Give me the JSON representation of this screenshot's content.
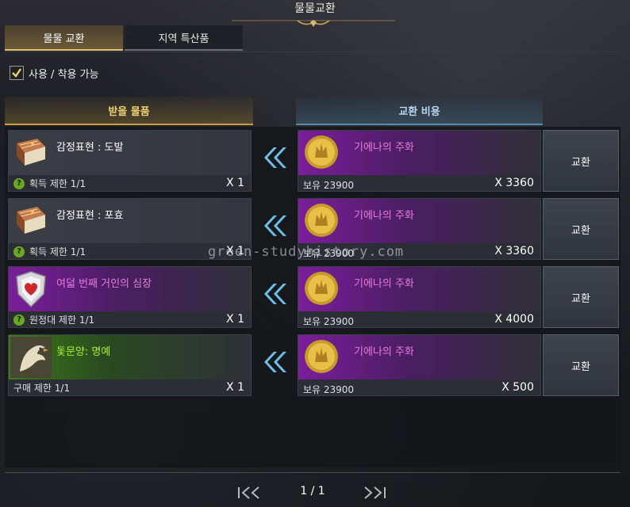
{
  "window": {
    "title": "물물교환"
  },
  "tabs": [
    {
      "label": "물물 교환",
      "active": true
    },
    {
      "label": "지역 특산품",
      "active": false
    }
  ],
  "filter": {
    "label": "사용 / 착용 가능",
    "checked": true
  },
  "columns": {
    "receive": "받을 물품",
    "cost": "교환 비용"
  },
  "rows": [
    {
      "reward": {
        "name": "감정표현 : 도발",
        "limit": "획득 제한 1/1",
        "qty": "X 1",
        "icon": "book-icon"
      },
      "cost": {
        "name": "기에나의 주화",
        "owned": "보유 23900",
        "qty": "X 3360",
        "icon": "gold-coin-icon"
      },
      "button": "교환"
    },
    {
      "reward": {
        "name": "감정표현 : 포효",
        "limit": "획득 제한 1/1",
        "qty": "X 1",
        "icon": "book-icon"
      },
      "cost": {
        "name": "기에나의 주화",
        "owned": "보유 23900",
        "qty": "X 3360",
        "icon": "gold-coin-icon"
      },
      "button": "교환"
    },
    {
      "reward": {
        "name": "여덟 번째 거인의 심장",
        "limit": "원정대 제한 1/1",
        "qty": "X 1",
        "icon": "giant-heart-shield-icon"
      },
      "cost": {
        "name": "기에나의 주화",
        "owned": "보유 23900",
        "qty": "X 4000",
        "icon": "gold-coin-icon"
      },
      "button": "교환"
    },
    {
      "reward": {
        "name": "돛문양: 명예",
        "limit": "구매 제한 1/1",
        "qty": "X 1",
        "icon": "eagle-sail-icon"
      },
      "cost": {
        "name": "기에나의 주화",
        "owned": "보유 23900",
        "qty": "X 500",
        "icon": "gold-coin-icon"
      },
      "button": "교환"
    }
  ],
  "pagination": {
    "current": "1 / 1"
  },
  "watermark": "green-studyhistory.com",
  "colors": {
    "accent_gold": "#e0c070",
    "accent_blue": "#5a8aa8",
    "item_purple": "#7a1e9a",
    "item_green": "#3b7a18",
    "name_pink": "#e77ae0",
    "name_lime": "#a8f02e"
  }
}
